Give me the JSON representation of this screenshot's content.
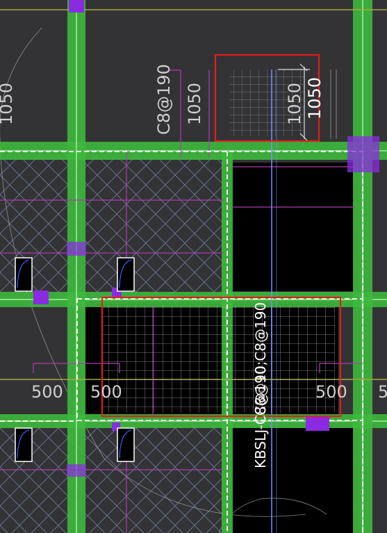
{
  "view": {
    "background": "#333335",
    "colors": {
      "beam": "#3db83d",
      "beam_core": "#6fd46f",
      "rebar_magenta": "#b03cb0",
      "hatch": "#7f8fb5",
      "highlight_box": "#e0201a",
      "axis_line": "#a8a840",
      "slab_void": "#000000",
      "column": "#8a2be2",
      "blue_line": "#7b8fff",
      "dim_text": "#d0d0d0",
      "label_text": "#ffffff"
    }
  },
  "annotations": {
    "dim_left_edge": "1050",
    "rebar_spec_top": "C8@190",
    "dim_top_mid": "1050",
    "dim_box_inner": "1050",
    "dim_box_outer": "1050",
    "dim_left_500": "500",
    "dim_center_500": "500",
    "dim_right_500": "500",
    "dim_edge_5": "5",
    "rebar_spec_vertical": "KBSLJ-C8@190;C8@190",
    "rebar_spec_overlay": "C8@10"
  },
  "selections": [
    {
      "name": "selection-box-top",
      "label": ""
    },
    {
      "name": "selection-box-center",
      "label": ""
    }
  ]
}
